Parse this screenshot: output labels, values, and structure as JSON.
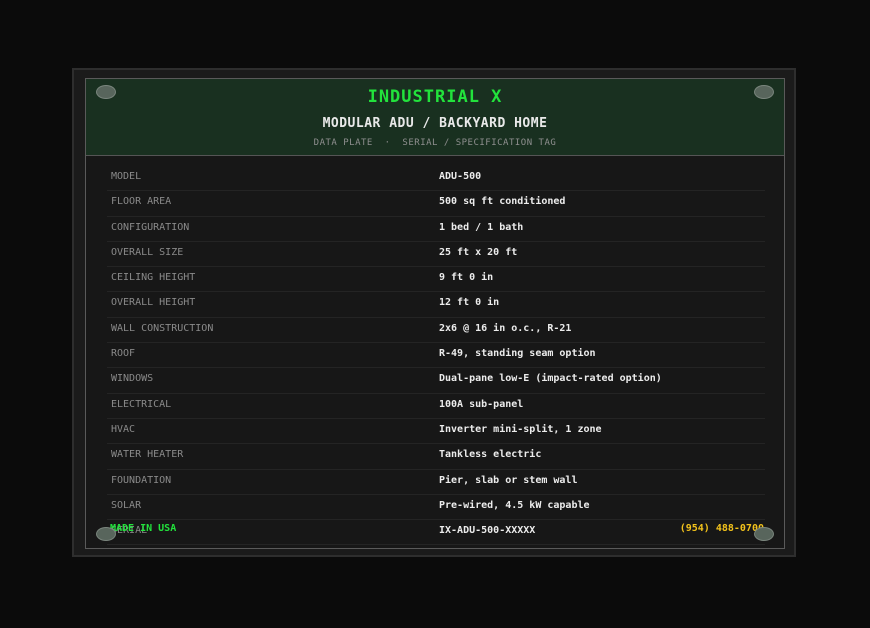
{
  "plate": {
    "brand": "INDUSTRIAL X",
    "product": "MODULAR ADU / BACKYARD HOME",
    "subtitle": "DATA PLATE  ·  SERIAL / SPECIFICATION TAG",
    "specs": [
      {
        "label": "MODEL",
        "value": "ADU-500"
      },
      {
        "label": "FLOOR AREA",
        "value": "500 sq ft conditioned"
      },
      {
        "label": "CONFIGURATION",
        "value": "1 bed / 1 bath"
      },
      {
        "label": "OVERALL SIZE",
        "value": "25 ft x 20 ft"
      },
      {
        "label": "CEILING HEIGHT",
        "value": "9 ft 0 in"
      },
      {
        "label": "OVERALL HEIGHT",
        "value": "12 ft 0 in"
      },
      {
        "label": "WALL CONSTRUCTION",
        "value": "2x6 @ 16 in o.c., R-21"
      },
      {
        "label": "ROOF",
        "value": "R-49, standing seam option"
      },
      {
        "label": "WINDOWS",
        "value": "Dual-pane low-E (impact-rated option)"
      },
      {
        "label": "ELECTRICAL",
        "value": "100A sub-panel"
      },
      {
        "label": "HVAC",
        "value": "Inverter mini-split, 1 zone"
      },
      {
        "label": "WATER HEATER",
        "value": "Tankless electric"
      },
      {
        "label": "FOUNDATION",
        "value": "Pier, slab or stem wall"
      },
      {
        "label": "SOLAR",
        "value": "Pre-wired, 4.5 kW capable"
      },
      {
        "label": "SERIAL",
        "value": "IX-ADU-500-XXXXX"
      }
    ],
    "footer_left": "MADE IN USA",
    "footer_right": "(954) 488-0700"
  },
  "colors": {
    "accent_green": "#22e23c",
    "phone_yellow": "#f2c21b",
    "header_bg": "#193020"
  }
}
